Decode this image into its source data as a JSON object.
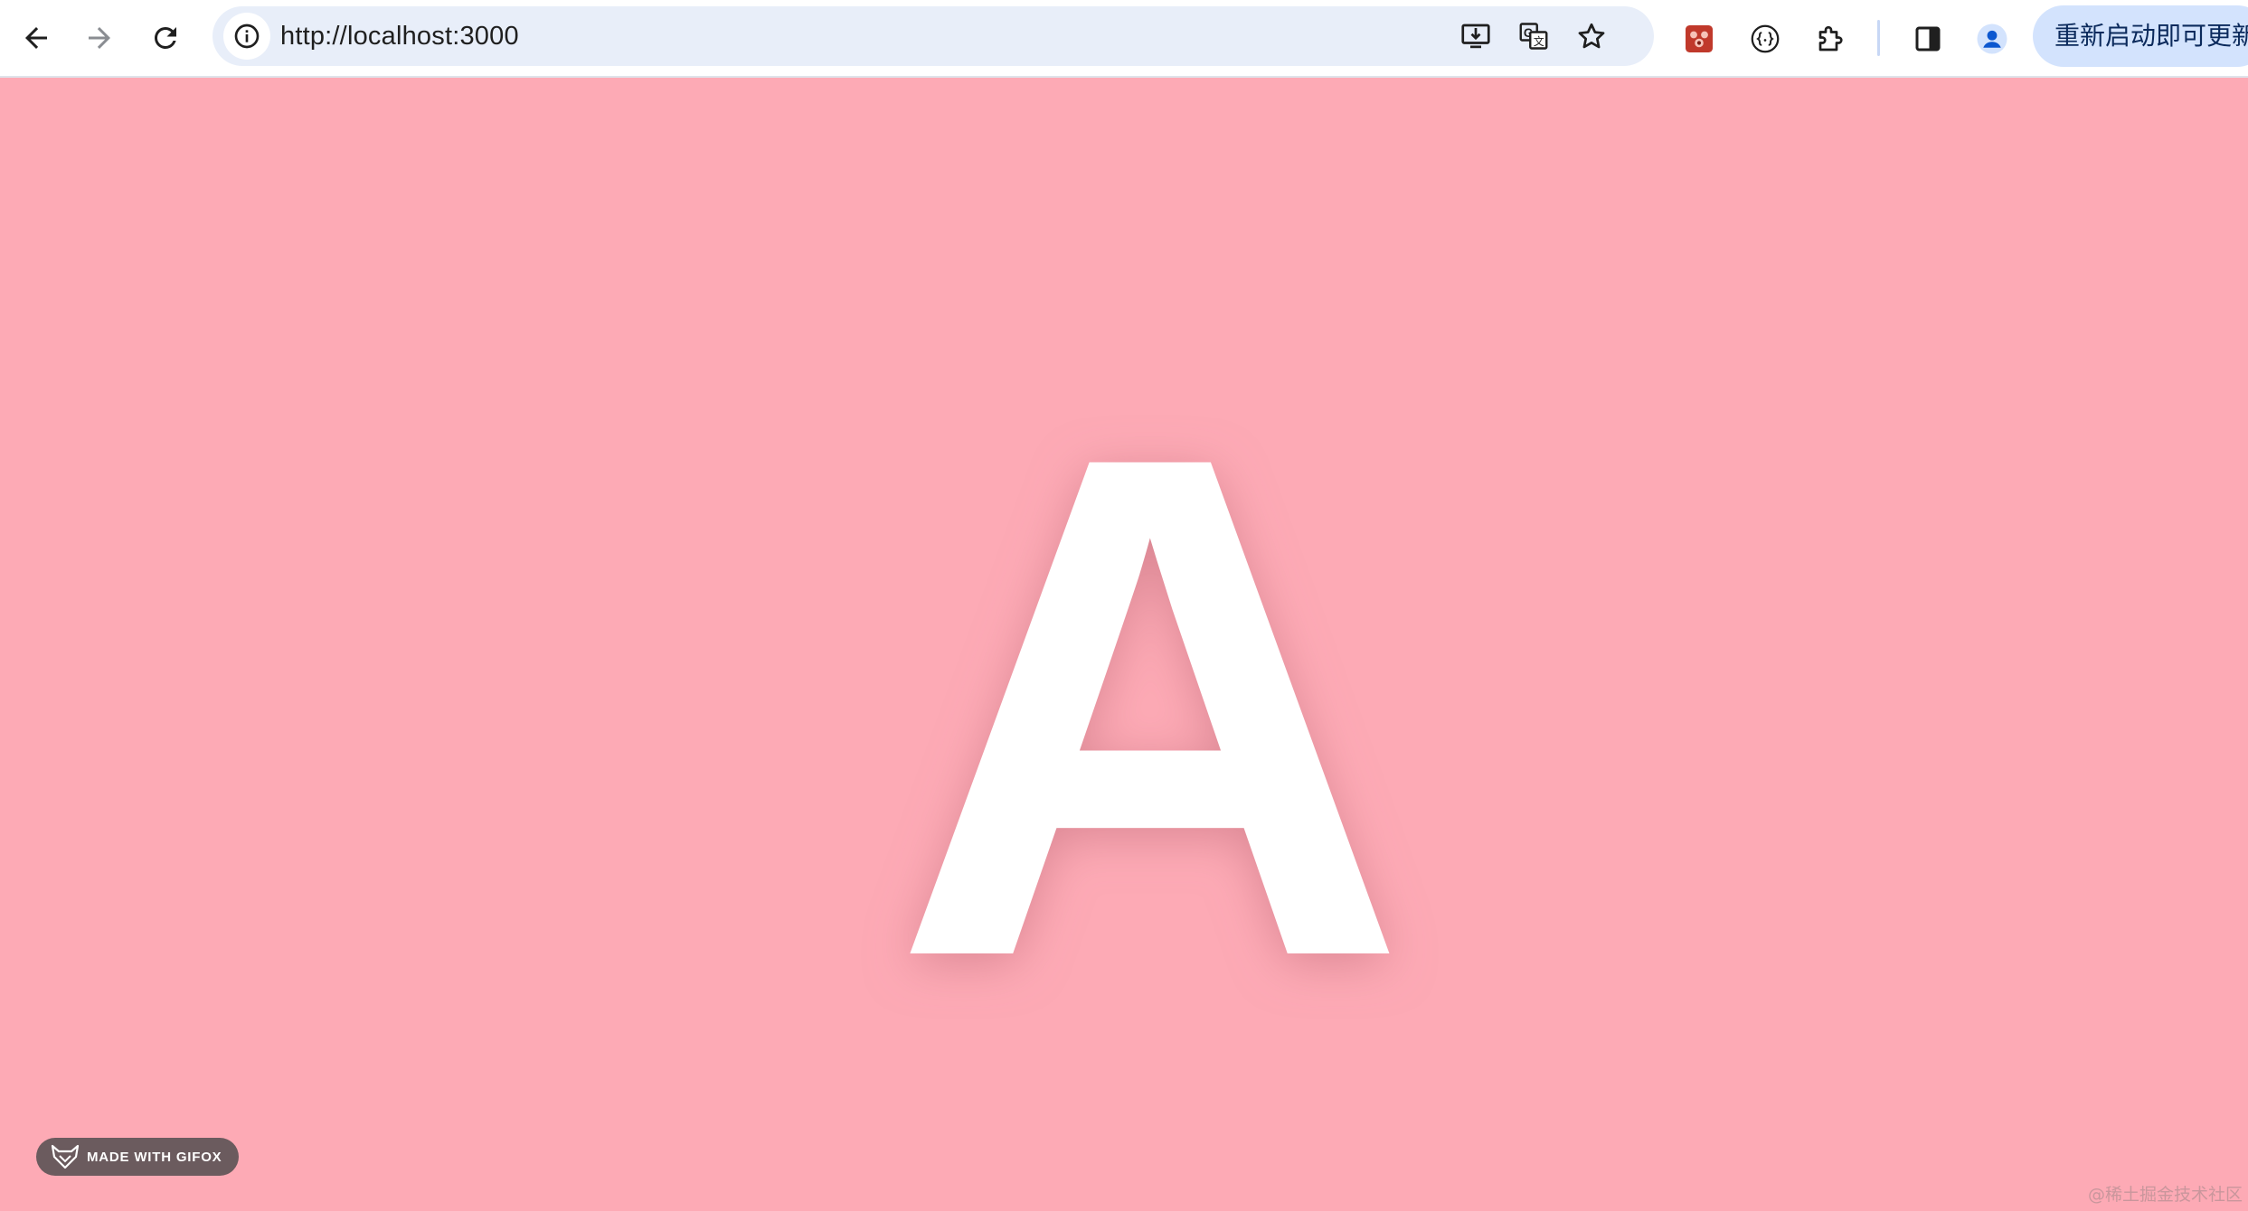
{
  "browser": {
    "url": "http://localhost:3000",
    "update_button_label": "重新启动即可更新"
  },
  "page": {
    "background_color": "#fdaab5",
    "display_letter": "A",
    "letter_color": "#ffffff"
  },
  "badge": {
    "label": "MADE WITH GIFOX"
  },
  "watermark": {
    "text": "@稀土掘金技术社区"
  },
  "icons": {
    "back": "arrow-left-icon",
    "forward": "arrow-right-icon",
    "reload": "reload-icon",
    "site_info": "info-icon",
    "install": "install-app-icon",
    "translate": "translate-icon",
    "bookmark": "star-icon",
    "extension_1": "red-extension-icon",
    "extension_2": "json-braces-icon",
    "extensions_menu": "puzzle-icon",
    "side_panel": "side-panel-icon",
    "profile": "profile-avatar-icon",
    "gifox": "gifox-fox-icon"
  }
}
